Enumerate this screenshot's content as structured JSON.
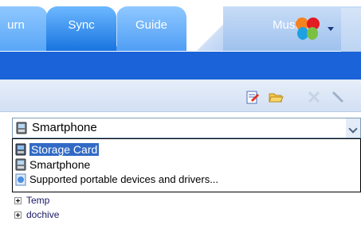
{
  "tabs": [
    {
      "label": "urn"
    },
    {
      "label": "Sync"
    },
    {
      "label": "Guide"
    },
    {
      "label": "Musi"
    }
  ],
  "toolbar": {
    "icons": [
      "edit-note-icon",
      "open-folder-icon",
      "delete-x-icon",
      "pen-icon"
    ]
  },
  "device_combo": {
    "selected": "Smartphone"
  },
  "device_dropdown": {
    "items": [
      {
        "label": "Storage Card",
        "icon": "storage-card-icon"
      },
      {
        "label": "Smartphone",
        "icon": "smartphone-icon"
      },
      {
        "label": "Supported portable devices and drivers...",
        "icon": "help-globe-icon"
      }
    ]
  },
  "tree": {
    "items": [
      {
        "label": "Temp"
      },
      {
        "label": "dochive"
      }
    ]
  },
  "colors": {
    "accent": "#1b63d8",
    "selection": "#316ac5"
  }
}
